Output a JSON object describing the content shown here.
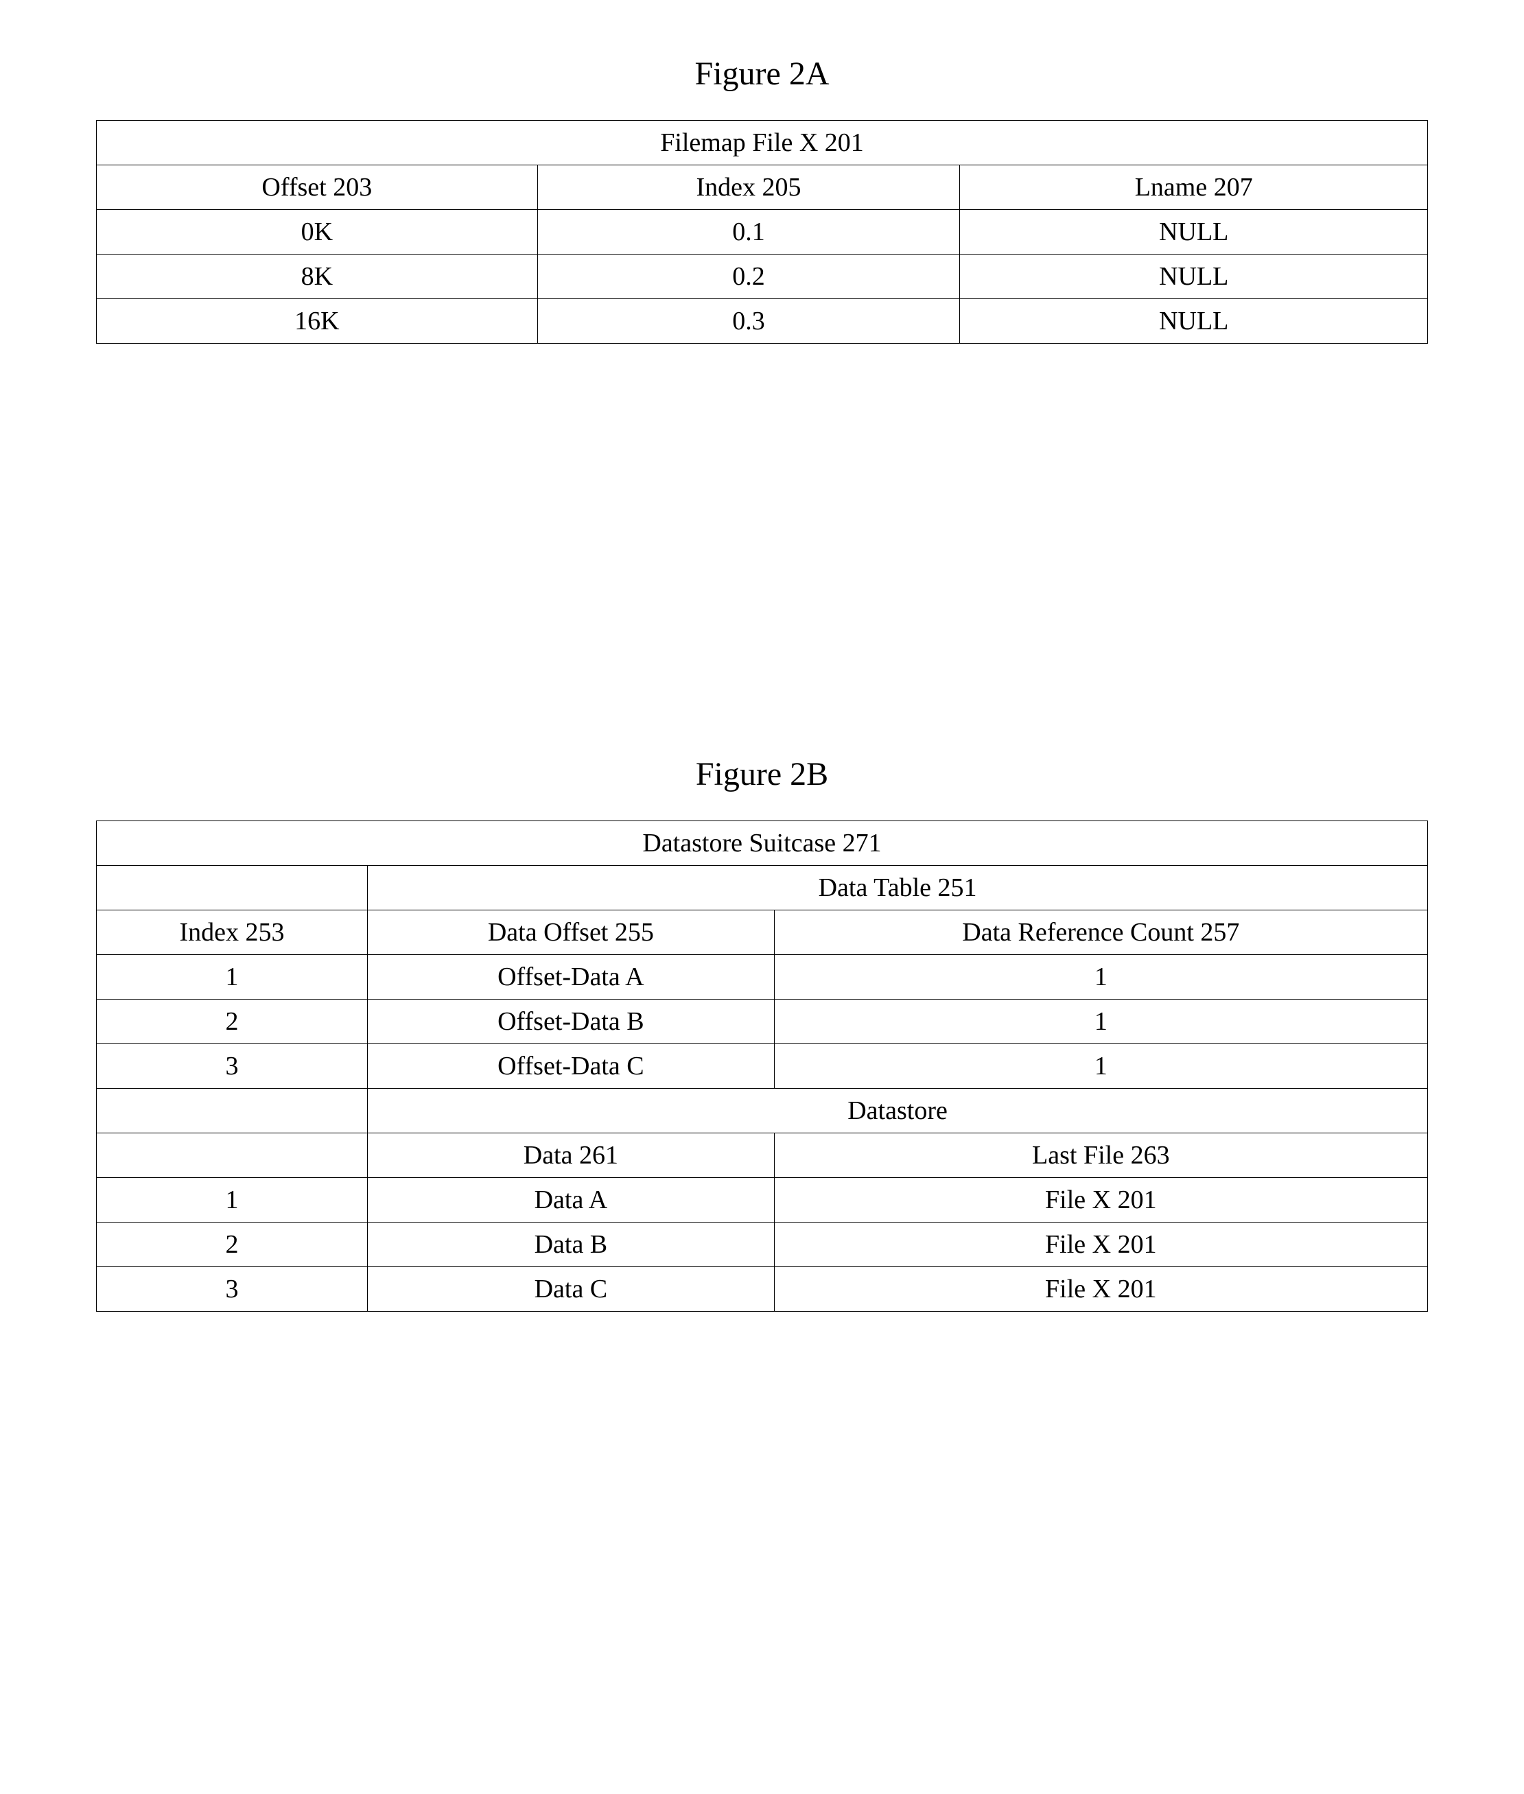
{
  "figure2a": {
    "title": "Figure 2A",
    "table": {
      "caption": "Filemap File X 201",
      "headers": {
        "offset": "Offset 203",
        "index": "Index 205",
        "lname": "Lname 207"
      },
      "rows": [
        {
          "offset": "0K",
          "index": "0.1",
          "lname": "NULL"
        },
        {
          "offset": "8K",
          "index": "0.2",
          "lname": "NULL"
        },
        {
          "offset": "16K",
          "index": "0.3",
          "lname": "NULL"
        }
      ]
    }
  },
  "figure2b": {
    "title": "Figure 2B",
    "table": {
      "caption": "Datastore Suitcase 271",
      "section1_caption": "Data Table 251",
      "section1_headers": {
        "index": "Index 253",
        "data_offset": "Data Offset 255",
        "data_ref_count": "Data Reference Count 257"
      },
      "section1_rows": [
        {
          "index": "1",
          "data_offset": "Offset-Data A",
          "data_ref_count": "1"
        },
        {
          "index": "2",
          "data_offset": "Offset-Data B",
          "data_ref_count": "1"
        },
        {
          "index": "3",
          "data_offset": "Offset-Data C",
          "data_ref_count": "1"
        }
      ],
      "section2_caption": "Datastore",
      "section2_headers": {
        "data": "Data 261",
        "last_file": "Last File 263"
      },
      "section2_rows": [
        {
          "index": "1",
          "data": "Data A",
          "last_file": "File X 201"
        },
        {
          "index": "2",
          "data": "Data B",
          "last_file": "File X 201"
        },
        {
          "index": "3",
          "data": "Data C",
          "last_file": "File X 201"
        }
      ]
    }
  }
}
